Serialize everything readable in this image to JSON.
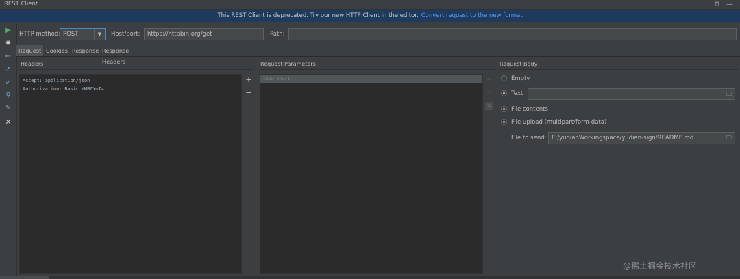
{
  "window": {
    "title": "REST Client"
  },
  "banner": {
    "text": "This REST Client is deprecated. Try our new HTTP Client in the editor.",
    "link": "Convert request to the new format"
  },
  "toolbar_icons": [
    "run-icon",
    "debug-icon",
    "back-icon",
    "export-icon",
    "import-icon",
    "generate-icon",
    "settings-wrench-icon",
    "close-icon"
  ],
  "form": {
    "method_label": "HTTP method:",
    "method_value": "POST",
    "host_label": "Host/port:",
    "host_value": "https://httpbin.org/get",
    "path_label": "Path:",
    "path_value": ""
  },
  "tabs": [
    {
      "label": "Request",
      "active": true
    },
    {
      "label": "Cookies",
      "active": false
    },
    {
      "label": "Response",
      "active": false
    },
    {
      "label": "Response Headers",
      "active": false
    }
  ],
  "headers": {
    "title": "Headers",
    "lines": [
      "Accept: application/json",
      "Authorization: Basic YWB6YmI="
    ],
    "add": "+",
    "remove": "−"
  },
  "params": {
    "title": "Request Parameters",
    "rows": [
      "show_env=1"
    ],
    "add": "+",
    "remove": "−",
    "delete": "×"
  },
  "body": {
    "title": "Request Body",
    "options": [
      {
        "label": "Empty",
        "selected": false
      },
      {
        "label": "Text",
        "selected": true
      },
      {
        "label": "File contents",
        "selected": true
      },
      {
        "label": "File upload (multipart/form-data)",
        "selected": true
      }
    ],
    "text_value": "",
    "file_to_send_label": "File to send:",
    "file_to_send_value": "E:/yudianWorkingspace/yudian-sign/README.md"
  },
  "watermark": "@稀土掘金技术社区",
  "colors": {
    "background": "#3c3f41",
    "editor": "#2b2b2b",
    "banner": "#1e3a5c",
    "link": "#589df6",
    "run": "#59a869",
    "focus": "#4a88c7"
  }
}
